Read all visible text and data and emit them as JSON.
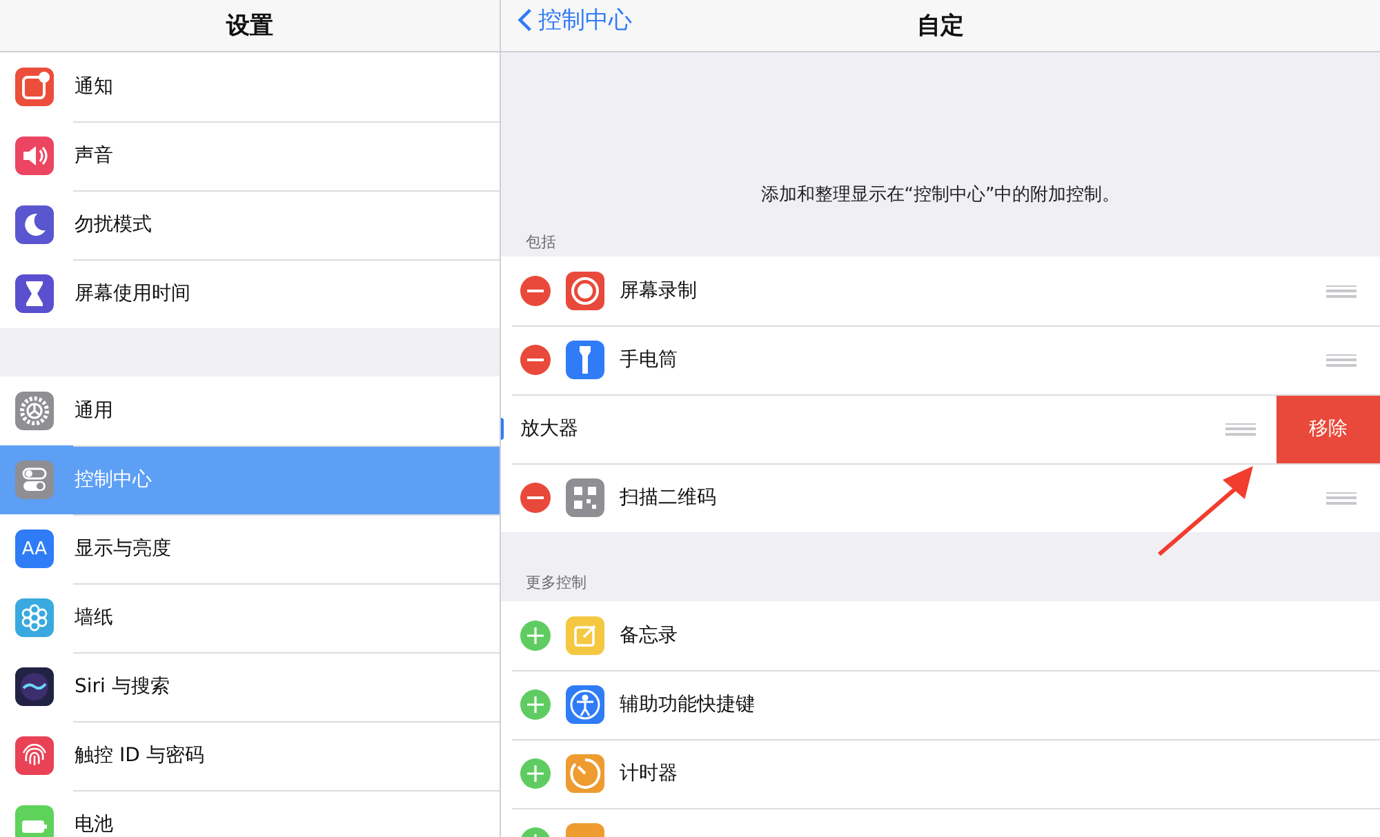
{
  "sidebar": {
    "title": "设置",
    "groups": [
      [
        {
          "label": "通知",
          "selected": false
        },
        {
          "label": "声音",
          "selected": false
        },
        {
          "label": "勿扰模式",
          "selected": false
        },
        {
          "label": "屏幕使用时间",
          "selected": false
        }
      ],
      [
        {
          "label": "通用",
          "selected": false
        },
        {
          "label": "控制中心",
          "selected": true
        },
        {
          "label": "显示与亮度",
          "icon_text": "AA",
          "selected": false
        },
        {
          "label": "墙纸",
          "selected": false
        },
        {
          "label": "Siri 与搜索",
          "selected": false
        },
        {
          "label": "触控 ID 与密码",
          "selected": false
        },
        {
          "label": "电池",
          "selected": false
        }
      ]
    ]
  },
  "detail": {
    "back": "控制中心",
    "title": "自定",
    "description": "添加和整理显示在“控制中心”中的附加控制。",
    "sections": [
      {
        "header": "包括",
        "items": [
          {
            "kind": "remove",
            "label": "屏幕录制"
          },
          {
            "kind": "remove",
            "label": "手电筒"
          },
          {
            "kind": "swiped",
            "label": "放大器",
            "action": "移除"
          },
          {
            "kind": "remove",
            "label": "扫描二维码"
          }
        ]
      },
      {
        "header": "更多控制",
        "items": [
          {
            "kind": "add",
            "label": "备忘录"
          },
          {
            "kind": "add",
            "label": "辅助功能快捷键"
          },
          {
            "kind": "add",
            "label": "计时器"
          },
          {
            "kind": "add"
          }
        ]
      }
    ]
  },
  "annotation": {
    "kind": "arrow"
  }
}
